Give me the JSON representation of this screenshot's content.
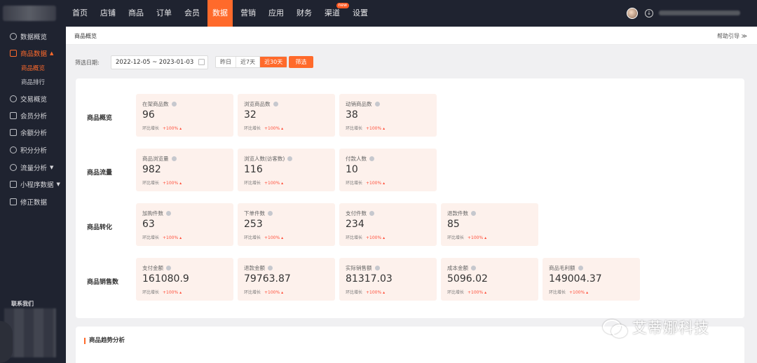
{
  "topbar": {
    "nav": [
      {
        "label": "首页",
        "active": false,
        "badge": ""
      },
      {
        "label": "店铺",
        "active": false,
        "badge": ""
      },
      {
        "label": "商品",
        "active": false,
        "badge": ""
      },
      {
        "label": "订单",
        "active": false,
        "badge": ""
      },
      {
        "label": "会员",
        "active": false,
        "badge": ""
      },
      {
        "label": "数据",
        "active": true,
        "badge": ""
      },
      {
        "label": "营销",
        "active": false,
        "badge": ""
      },
      {
        "label": "应用",
        "active": false,
        "badge": ""
      },
      {
        "label": "财务",
        "active": false,
        "badge": ""
      },
      {
        "label": "渠道",
        "active": false,
        "badge": "new"
      },
      {
        "label": "设置",
        "active": false,
        "badge": ""
      }
    ]
  },
  "sidebar": {
    "items": [
      {
        "label": "数据概览",
        "icon": "clock-icon"
      },
      {
        "label": "商品数据",
        "icon": "box-icon",
        "caret": "▲",
        "active": true
      },
      {
        "label": "交易概览",
        "icon": "trade-icon"
      },
      {
        "label": "会员分析",
        "icon": "member-icon"
      },
      {
        "label": "余额分析",
        "icon": "wallet-icon"
      },
      {
        "label": "积分分析",
        "icon": "points-icon"
      },
      {
        "label": "流量分析",
        "icon": "flow-icon",
        "caret": "▼"
      },
      {
        "label": "小程序数据",
        "icon": "miniprogram-icon",
        "caret": "▼"
      },
      {
        "label": "修正数据",
        "icon": "edit-icon"
      }
    ],
    "sub_items": [
      {
        "label": "商品概览",
        "active": true
      },
      {
        "label": "商品排行",
        "active": false
      }
    ],
    "contact_label": "联系我们"
  },
  "breadcrumb": "商品概览",
  "help_link": "帮助引导 ≫",
  "filter": {
    "label": "筛选日期:",
    "date_range": "2022-12-05 ~ 2023-01-03",
    "quick": [
      {
        "label": "昨日",
        "on": false
      },
      {
        "label": "近7天",
        "on": false
      },
      {
        "label": "近30天",
        "on": true
      }
    ],
    "button": "筛选"
  },
  "ratio_label": "环比增长",
  "sections": [
    {
      "label": "商品概览",
      "cards": [
        {
          "title": "在架商品数",
          "value": "96",
          "ratio": "+100%"
        },
        {
          "title": "浏览商品数",
          "value": "32",
          "ratio": "+100%"
        },
        {
          "title": "动销商品数",
          "value": "38",
          "ratio": "+100%"
        }
      ]
    },
    {
      "label": "商品流量",
      "cards": [
        {
          "title": "商品浏览量",
          "value": "982",
          "ratio": "+100%"
        },
        {
          "title": "浏览人数(访客数)",
          "value": "116",
          "ratio": "+100%"
        },
        {
          "title": "付款人数",
          "value": "10",
          "ratio": "+100%"
        }
      ]
    },
    {
      "label": "商品转化",
      "cards": [
        {
          "title": "加购件数",
          "value": "63",
          "ratio": "+100%"
        },
        {
          "title": "下单件数",
          "value": "253",
          "ratio": "+100%"
        },
        {
          "title": "支付件数",
          "value": "234",
          "ratio": "+100%"
        },
        {
          "title": "退款件数",
          "value": "85",
          "ratio": "+100%"
        }
      ]
    },
    {
      "label": "商品销售数",
      "cards": [
        {
          "title": "支付金额",
          "value": "161080.9",
          "ratio": "+100%"
        },
        {
          "title": "退款金额",
          "value": "79763.87",
          "ratio": "+100%"
        },
        {
          "title": "实际销售额",
          "value": "81317.03",
          "ratio": "+100%"
        },
        {
          "title": "成本金额",
          "value": "5096.02",
          "ratio": "+100%"
        },
        {
          "title": "商品毛利额",
          "value": "149004.37",
          "ratio": "+100%"
        }
      ]
    }
  ],
  "trend_title": "商品趋势分析",
  "watermark": "艾蒂娜科技",
  "colors": {
    "accent": "#ff6a2b",
    "topbar": "#1f2330",
    "card_bg": "#fdf1ec",
    "ratio_up": "#ff4f3a"
  }
}
